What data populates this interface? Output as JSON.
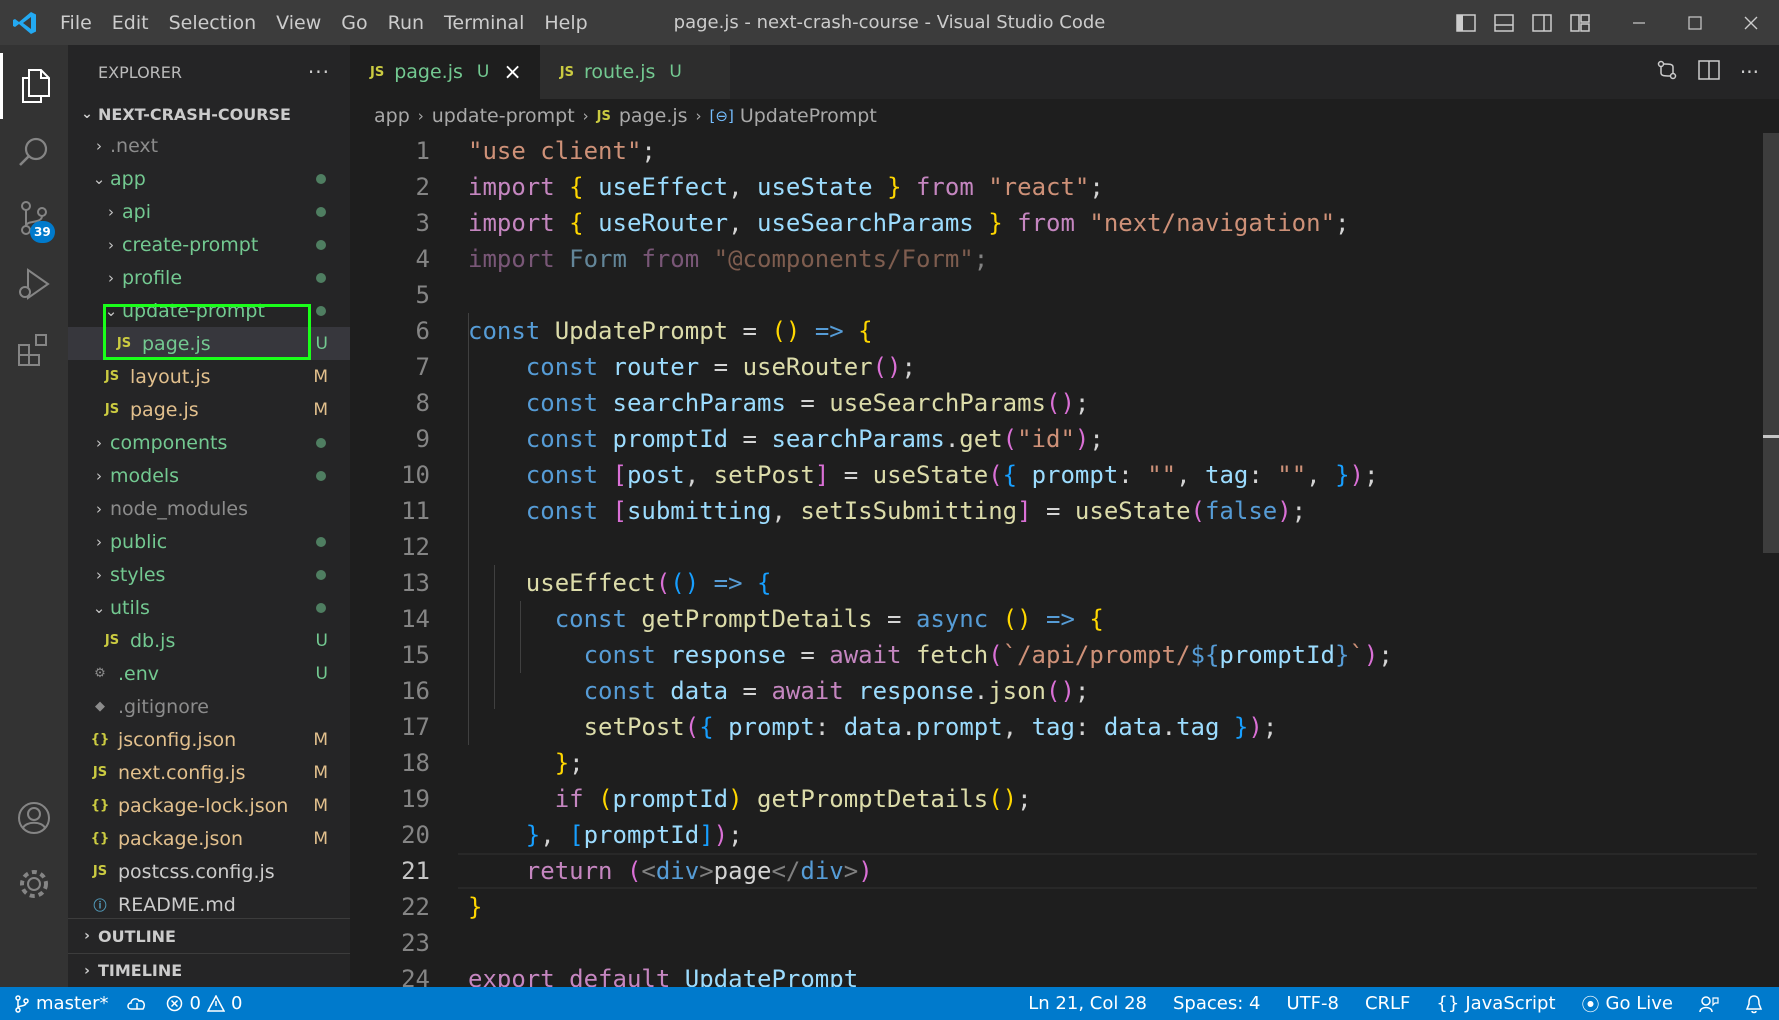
{
  "window": {
    "title": "page.js - next-crash-course - Visual Studio Code",
    "menu": [
      "File",
      "Edit",
      "Selection",
      "View",
      "Go",
      "Run",
      "Terminal",
      "Help"
    ],
    "accent": "#007acc"
  },
  "activity_bar": {
    "items": [
      "explorer",
      "search",
      "source-control",
      "run-debug",
      "extensions"
    ],
    "source_control_badge": "39"
  },
  "sidebar": {
    "header": "EXPLORER",
    "more": "···",
    "project": "NEXT-CRASH-COURSE",
    "tree": [
      {
        "label": ".next",
        "kind": "folder",
        "state": "collapsed",
        "status": "",
        "color": "gray"
      },
      {
        "label": "app",
        "kind": "folder",
        "state": "expanded",
        "status": "dot",
        "color": "green"
      },
      {
        "label": "api",
        "kind": "folder",
        "state": "collapsed",
        "status": "dot",
        "color": "green"
      },
      {
        "label": "create-prompt",
        "kind": "folder",
        "state": "collapsed",
        "status": "dot",
        "color": "green"
      },
      {
        "label": "profile",
        "kind": "folder",
        "state": "collapsed",
        "status": "dot",
        "color": "green"
      },
      {
        "label": "update-prompt",
        "kind": "folder",
        "state": "expanded",
        "status": "dot",
        "color": "green"
      },
      {
        "label": "page.js",
        "kind": "js",
        "status": "U",
        "color": "green"
      },
      {
        "label": "layout.js",
        "kind": "js",
        "status": "M",
        "color": "mod"
      },
      {
        "label": "page.js",
        "kind": "js",
        "status": "M",
        "color": "mod"
      },
      {
        "label": "components",
        "kind": "folder",
        "state": "collapsed",
        "status": "dot",
        "color": "green"
      },
      {
        "label": "models",
        "kind": "folder",
        "state": "collapsed",
        "status": "dot",
        "color": "green"
      },
      {
        "label": "node_modules",
        "kind": "folder",
        "state": "collapsed",
        "status": "",
        "color": "gray"
      },
      {
        "label": "public",
        "kind": "folder",
        "state": "collapsed",
        "status": "dot",
        "color": "green"
      },
      {
        "label": "styles",
        "kind": "folder",
        "state": "collapsed",
        "status": "dot",
        "color": "green"
      },
      {
        "label": "utils",
        "kind": "folder",
        "state": "expanded",
        "status": "dot",
        "color": "green"
      },
      {
        "label": "db.js",
        "kind": "js",
        "status": "U",
        "color": "green"
      },
      {
        "label": ".env",
        "kind": "gear",
        "status": "U",
        "color": "green"
      },
      {
        "label": ".gitignore",
        "kind": "git",
        "status": "",
        "color": "gray"
      },
      {
        "label": "jsconfig.json",
        "kind": "json",
        "status": "M",
        "color": "mod"
      },
      {
        "label": "next.config.js",
        "kind": "js",
        "status": "M",
        "color": "mod"
      },
      {
        "label": "package-lock.json",
        "kind": "json",
        "status": "M",
        "color": "mod"
      },
      {
        "label": "package.json",
        "kind": "json",
        "status": "M",
        "color": "mod"
      },
      {
        "label": "postcss.config.js",
        "kind": "js",
        "status": "",
        "color": "plain"
      },
      {
        "label": "README.md",
        "kind": "info",
        "status": "",
        "color": "plain"
      }
    ],
    "outline": "OUTLINE",
    "timeline": "TIMELINE"
  },
  "tabs": [
    {
      "label": "page.js",
      "badge": "JS",
      "status": "U",
      "active": true
    },
    {
      "label": "route.js",
      "badge": "JS",
      "status": "U",
      "active": false
    }
  ],
  "breadcrumb": {
    "parts": [
      "app",
      "update-prompt",
      "page.js",
      "UpdatePrompt"
    ],
    "file_badge": "JS"
  },
  "editor": {
    "line_numbers": [
      "1",
      "2",
      "3",
      "4",
      "5",
      "6",
      "7",
      "8",
      "9",
      "10",
      "11",
      "12",
      "13",
      "14",
      "15",
      "16",
      "17",
      "18",
      "19",
      "20",
      "21",
      "22",
      "23",
      "24"
    ],
    "current_line": "21"
  },
  "statusbar": {
    "branch": "master*",
    "errors": "0",
    "warnings": "0",
    "position": "Ln 21, Col 28",
    "spaces": "Spaces: 4",
    "encoding": "UTF-8",
    "eol": "CRLF",
    "language": "JavaScript",
    "golive": "Go Live"
  }
}
